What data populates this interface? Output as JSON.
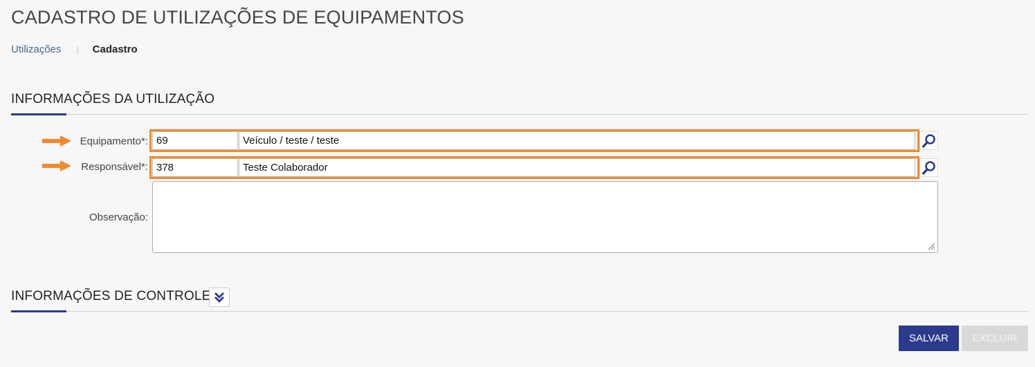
{
  "page": {
    "title": "CADASTRO DE UTILIZAÇÕES DE EQUIPAMENTOS"
  },
  "breadcrumb": {
    "parent": "Utilizações",
    "separator": "|",
    "current": "Cadastro"
  },
  "section_usage": {
    "title": "INFORMAÇÕES DA UTILIZAÇÃO",
    "equipment": {
      "label": "Equipamento*:",
      "code": "69",
      "description": "Veículo / teste / teste",
      "search_icon": "search-icon"
    },
    "responsible": {
      "label": "Responsável*:",
      "code": "378",
      "description": "Teste Colaborador",
      "search_icon": "search-icon"
    },
    "observation": {
      "label": "Observação:",
      "value": ""
    }
  },
  "section_control": {
    "title": "INFORMAÇÕES DE CONTROLE",
    "toggle_icon": "double-chevron-down-icon"
  },
  "actions": {
    "save_label": "SALVAR",
    "delete_label": "EXCLUIR"
  },
  "colors": {
    "primary": "#2b3a8c",
    "highlight": "#f08a2e",
    "disabled": "#d9d9d9"
  }
}
